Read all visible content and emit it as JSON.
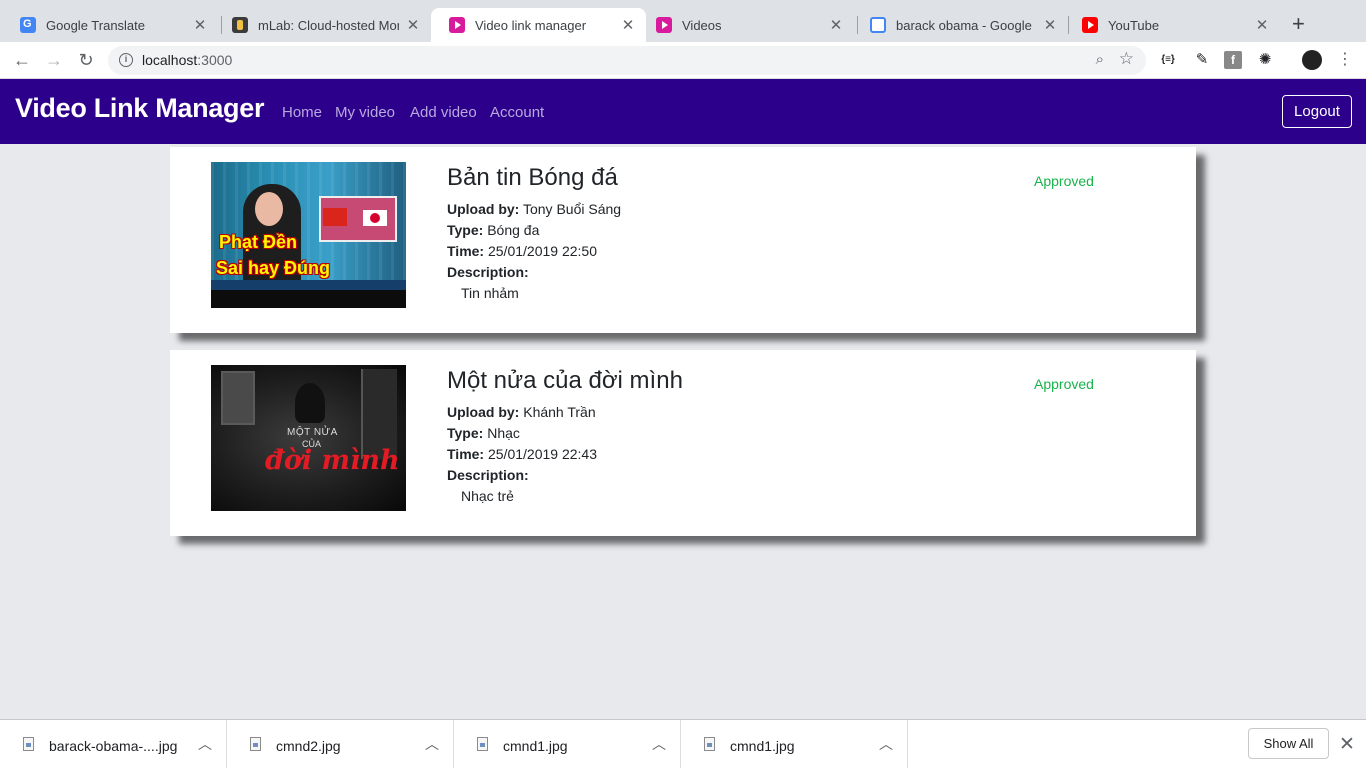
{
  "browser": {
    "tabs": [
      {
        "title": "Google Translate",
        "icon": "google-translate-icon"
      },
      {
        "title": "mLab: Cloud-hosted Mong",
        "icon": "mlab-icon"
      },
      {
        "title": "Video link manager",
        "icon": "video-play-icon"
      },
      {
        "title": "Videos",
        "icon": "video-play-icon"
      },
      {
        "title": "barack obama - Google Se",
        "icon": "google-icon"
      },
      {
        "title": "YouTube",
        "icon": "youtube-icon"
      }
    ],
    "active_tab": 2,
    "url_host": "localhost",
    "url_port": ":3000"
  },
  "navbar": {
    "brand": "Video Link Manager",
    "links": [
      "Home",
      "My video",
      "Add video",
      "Account"
    ],
    "logout": "Logout"
  },
  "labels": {
    "upload_by": "Upload by:",
    "type": "Type:",
    "time": "Time:",
    "description": "Description:"
  },
  "videos": [
    {
      "title": "Bản tin Bóng đá",
      "status": "Approved",
      "uploader": "Tony Buổi Sáng",
      "type": "Bóng đa",
      "time": "25/01/2019 22:50",
      "description": "Tin nhảm",
      "thumb_text": [
        "Phạt Đền",
        "Sai hay Đúng"
      ]
    },
    {
      "title": "Một nửa của đời mình",
      "status": "Approved",
      "uploader": "Khánh Trần",
      "type": "Nhạc",
      "time": "25/01/2019 22:43",
      "description": "Nhạc trẻ",
      "thumb_text": [
        "MỘT NỬA",
        "CỦA",
        "đời mình"
      ]
    }
  ],
  "downloads": [
    {
      "name": "barack-obama-....jpg"
    },
    {
      "name": "cmnd2.jpg"
    },
    {
      "name": "cmnd1.jpg"
    },
    {
      "name": "cmnd1.jpg"
    }
  ],
  "shelf": {
    "show_all": "Show All"
  },
  "colors": {
    "navbar": "#2d008b",
    "approved": "#18b34b"
  }
}
